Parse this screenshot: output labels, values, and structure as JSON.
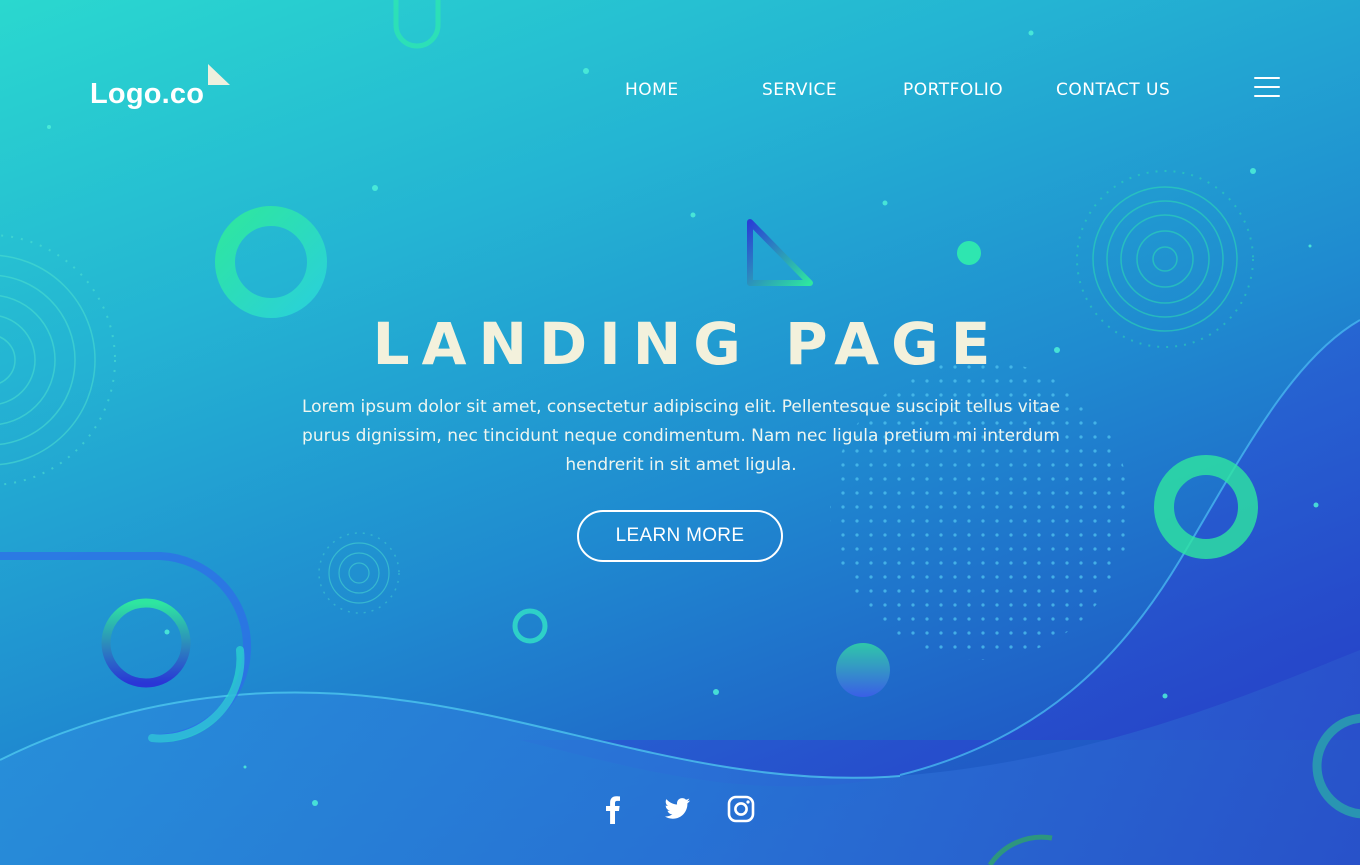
{
  "header": {
    "logo_text": "Logo.co",
    "nav": [
      {
        "label": "HOME"
      },
      {
        "label": "SERVICE"
      },
      {
        "label": "PORTFOLIO"
      },
      {
        "label": "CONTACT US"
      }
    ],
    "menu_icon": "hamburger-menu-icon"
  },
  "hero": {
    "title": "LANDING PAGE",
    "description": "Lorem ipsum dolor sit amet, consectetur adipiscing elit. Pellentesque suscipit tellus vitae purus dignissim, nec tincidunt neque condimentum. Nam nec ligula pretium mi interdum hendrerit in sit amet ligula.",
    "button_label": "LEARN MORE"
  },
  "social": {
    "icons": [
      "facebook-icon",
      "twitter-icon",
      "instagram-icon"
    ]
  },
  "colors": {
    "gradient_start": "#2ad8cf",
    "gradient_end": "#2447c0",
    "accent_green": "#2ee6a0",
    "title_color": "#f3f1dc"
  }
}
